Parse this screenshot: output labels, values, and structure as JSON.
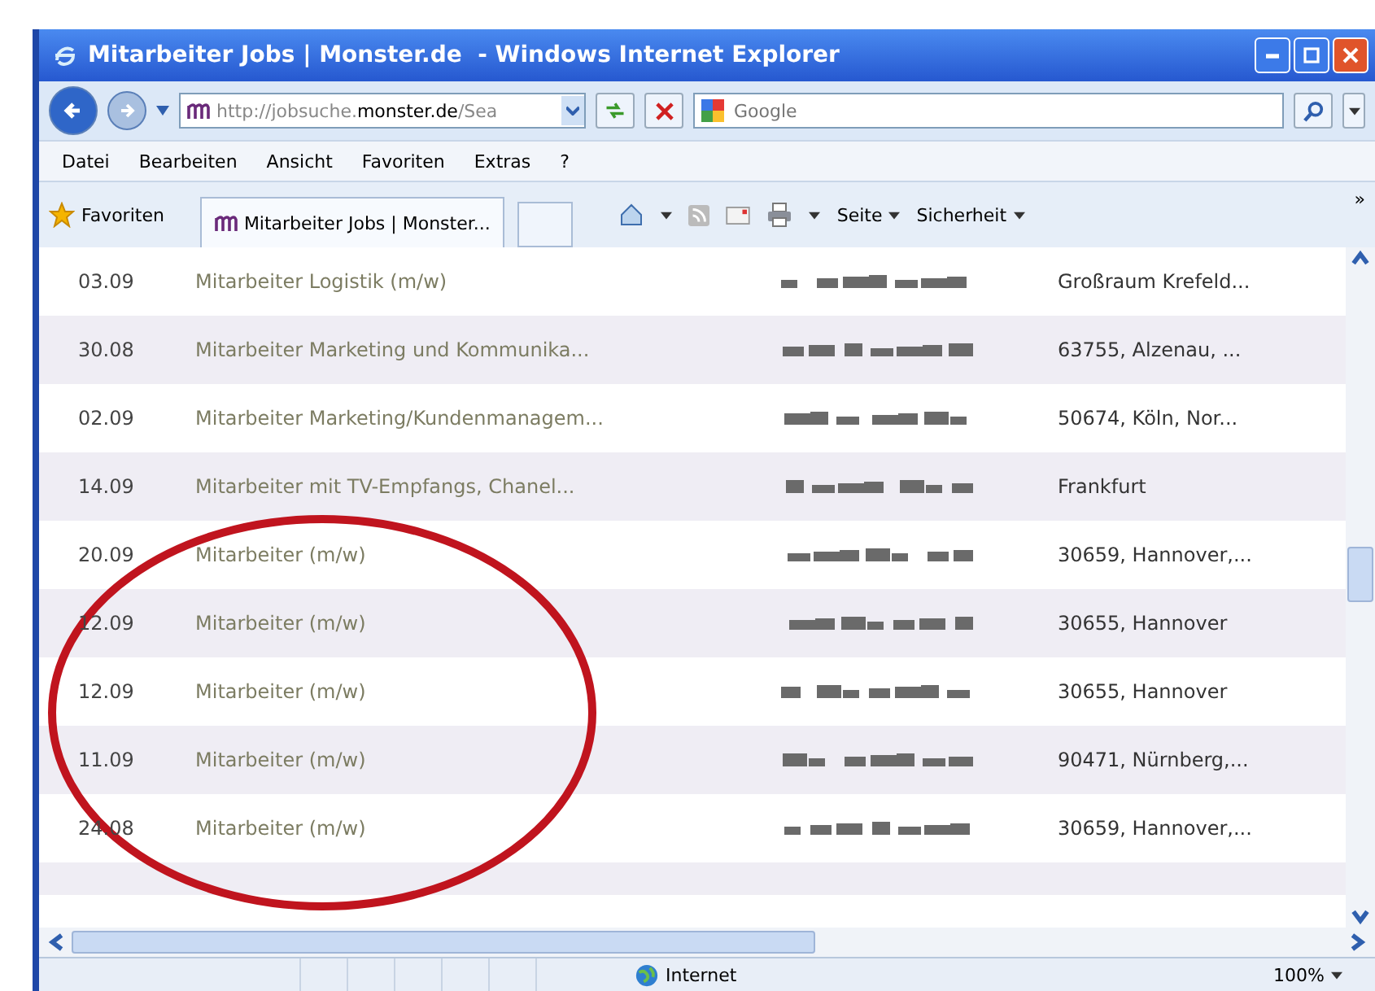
{
  "window": {
    "title": "Mitarbeiter Jobs | Monster.de  - Windows Internet Explorer"
  },
  "address_bar": {
    "url_prefix": "http://jobsuche.",
    "url_domain": "monster.de",
    "url_rest": "/Sea"
  },
  "search": {
    "placeholder": "Google"
  },
  "menu": [
    "Datei",
    "Bearbeiten",
    "Ansicht",
    "Favoriten",
    "Extras",
    "?"
  ],
  "favorites_button": "Favoriten",
  "tab": {
    "title": "Mitarbeiter Jobs | Monster..."
  },
  "command_bar": [
    "Seite",
    "Sicherheit"
  ],
  "toolbar_overflow": "»",
  "rows": [
    {
      "date": "03.09",
      "title": "Mitarbeiter Logistik (m/w)",
      "location": "Großraum Krefeld..."
    },
    {
      "date": "30.08",
      "title": "Mitarbeiter Marketing und Kommunika...",
      "location": "63755, Alzenau, ..."
    },
    {
      "date": "02.09",
      "title": "Mitarbeiter Marketing/Kundenmanagem...",
      "location": "50674, Köln, Nor..."
    },
    {
      "date": "14.09",
      "title": "Mitarbeiter mit TV-Empfangs, Chanel...",
      "location": "Frankfurt"
    },
    {
      "date": "20.09",
      "title": "Mitarbeiter (m/w)",
      "location": "30659, Hannover,..."
    },
    {
      "date": "12.09",
      "title": "Mitarbeiter (m/w)",
      "location": "30655, Hannover"
    },
    {
      "date": "12.09",
      "title": "Mitarbeiter (m/w)",
      "location": "30655, Hannover"
    },
    {
      "date": "11.09",
      "title": "Mitarbeiter (m/w)",
      "location": "90471, Nürnberg,..."
    },
    {
      "date": "24.08",
      "title": "Mitarbeiter (m/w)",
      "location": "30659, Hannover,..."
    }
  ],
  "status_bar": {
    "zone": "Internet",
    "zoom": "100%"
  }
}
